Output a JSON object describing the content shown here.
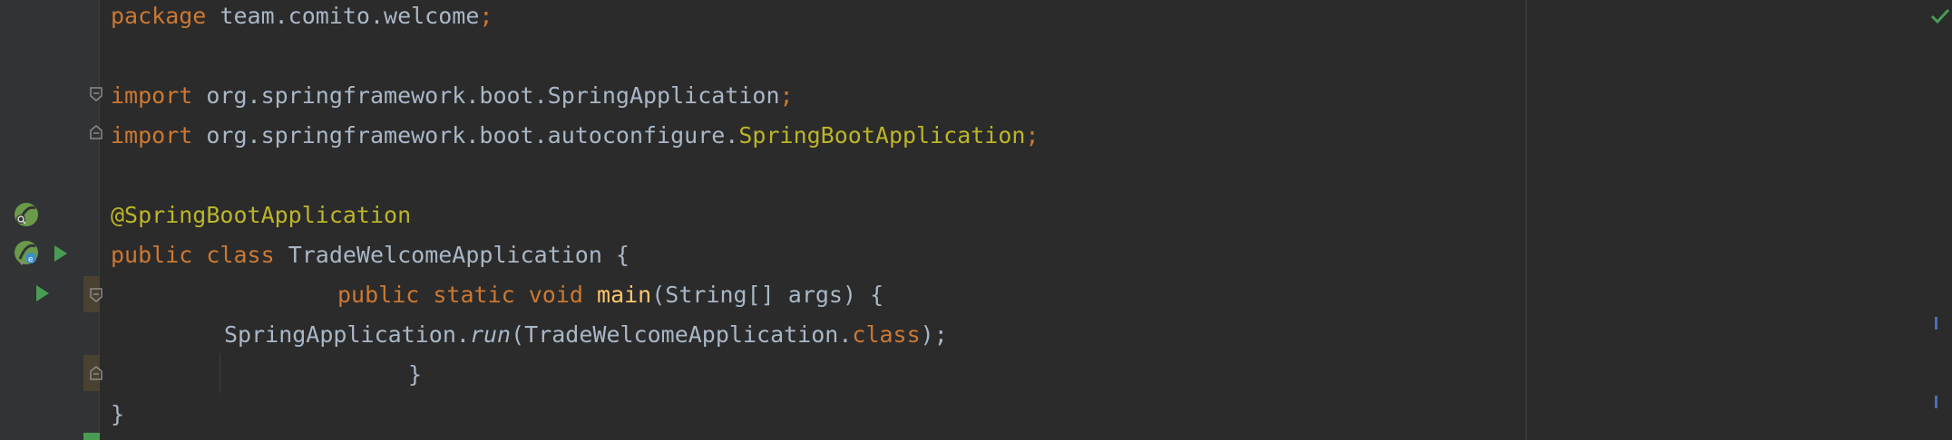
{
  "code": {
    "l1": {
      "kw": "package",
      "text": " team.comito.welcome",
      "semi": ";"
    },
    "l3": {
      "kw": "import",
      "text": " org.springframework.boot.SpringApplication",
      "semi": ";"
    },
    "l4": {
      "kw": "import",
      "text": " org.springframework.boot.autoconfigure.",
      "cls": "SpringBootApplication",
      "semi": ";"
    },
    "l6": {
      "annotation": "@SpringBootApplication"
    },
    "l7": {
      "kw1": "public",
      "kw2": "class",
      "text": " TradeWelcomeApplication {"
    },
    "l8": {
      "kw1": "public",
      "kw2": "static",
      "kw3": "void",
      "fn": "main",
      "text": "(String[] args) {"
    },
    "l9": {
      "text1": "SpringApplication.",
      "method": "run",
      "text2": "(TradeWelcomeApplication.",
      "kw": "class",
      "text3": ");"
    },
    "l10": {
      "text": "}"
    },
    "l11": {
      "text": "}"
    }
  },
  "gutter_icons": [
    "spring-bean-search-icon",
    "spring-bean-run-icon",
    "run-class-icon",
    "run-method-icon"
  ],
  "status": {
    "inspection": "check-icon"
  },
  "colors": {
    "keyword": "#cc7832",
    "annotation": "#bbb529",
    "function": "#ffc66d",
    "text": "#a9b7c6",
    "background": "#2b2b2b",
    "gutter": "#313335"
  }
}
